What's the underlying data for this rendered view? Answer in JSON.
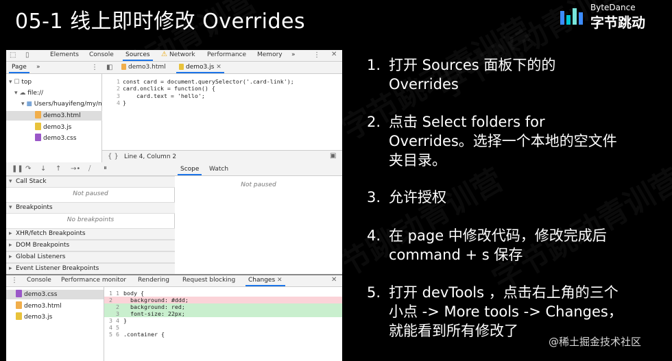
{
  "slide": {
    "title": "05-1 线上即时修改 Overrides",
    "brand_en": "ByteDance",
    "brand_cn": "字节跳动",
    "watermark": "字节跳动青训营",
    "juejin": "@稀土掘金技术社区"
  },
  "steps": [
    {
      "num": "1.",
      "text": "打开 Sources 面板下的的 Overrides"
    },
    {
      "num": "2.",
      "text": "点击 Select folders for Overrides。选择一个本地的空文件夹目录。"
    },
    {
      "num": "3.",
      "text": "允许授权"
    },
    {
      "num": "4.",
      "text": "在 page 中修改代码，修改完成后 command + s 保存"
    },
    {
      "num": "5.",
      "text": "打开 devTools ，点击右上角的三个小点 -> More tools -> Changes，就能看到所有修改了"
    }
  ],
  "devtools": {
    "tabs": [
      "Elements",
      "Console",
      "Sources",
      "Network",
      "Performance",
      "Memory",
      "»"
    ],
    "active_tab": "Sources",
    "nav": {
      "subtab": "Page",
      "more": "»",
      "tree": [
        "top",
        "file://",
        "Users/huayifeng/my/n",
        "demo3.html",
        "demo3.js",
        "demo3.css"
      ]
    },
    "editor": {
      "tabs": [
        "demo3.html",
        "demo3.js"
      ],
      "lines": [
        {
          "n": "1",
          "code": "const card = document.querySelector('.card-link');"
        },
        {
          "n": "2",
          "code": "card.onclick = function() {"
        },
        {
          "n": "3",
          "code": "    card.text = 'hello';"
        },
        {
          "n": "4",
          "code": "}"
        }
      ],
      "status": "Line 4, Column 2"
    },
    "debugger": {
      "sections": [
        {
          "label": "Call Stack",
          "msg": "Not paused"
        },
        {
          "label": "Breakpoints",
          "msg": "No breakpoints"
        },
        {
          "label": "XHR/fetch Breakpoints"
        },
        {
          "label": "DOM Breakpoints"
        },
        {
          "label": "Global Listeners"
        },
        {
          "label": "Event Listener Breakpoints"
        }
      ]
    },
    "scope": {
      "tabs": [
        "Scope",
        "Watch"
      ],
      "msg": "Not paused"
    },
    "drawer": {
      "tabs": [
        "Console",
        "Performance monitor",
        "Rendering",
        "Request blocking",
        "Changes"
      ],
      "active_tab": "Changes",
      "files": [
        "demo3.css",
        "demo3.html",
        "demo3.js"
      ],
      "diff": [
        {
          "n1": "1",
          "n2": "1",
          "text": "body {",
          "type": "ctx"
        },
        {
          "n1": "2",
          "n2": "",
          "text": "  background: #ddd;",
          "type": "del"
        },
        {
          "n1": "",
          "n2": "2",
          "text": "  background: red;",
          "type": "add"
        },
        {
          "n1": "",
          "n2": "3",
          "text": "  font-size: 22px;",
          "type": "add"
        },
        {
          "n1": "3",
          "n2": "4",
          "text": "}",
          "type": "ctx"
        },
        {
          "n1": "4",
          "n2": "5",
          "text": "",
          "type": "ctx"
        },
        {
          "n1": "5",
          "n2": "6",
          "text": ".container {",
          "type": "ctx"
        }
      ]
    }
  },
  "colors": {
    "accent": "#1a73e8",
    "html_file": "#f1ae4b",
    "js_file": "#e8c23b",
    "css_file": "#9a57c8",
    "deleted": "#fbd3d8",
    "added": "#c9efce"
  }
}
